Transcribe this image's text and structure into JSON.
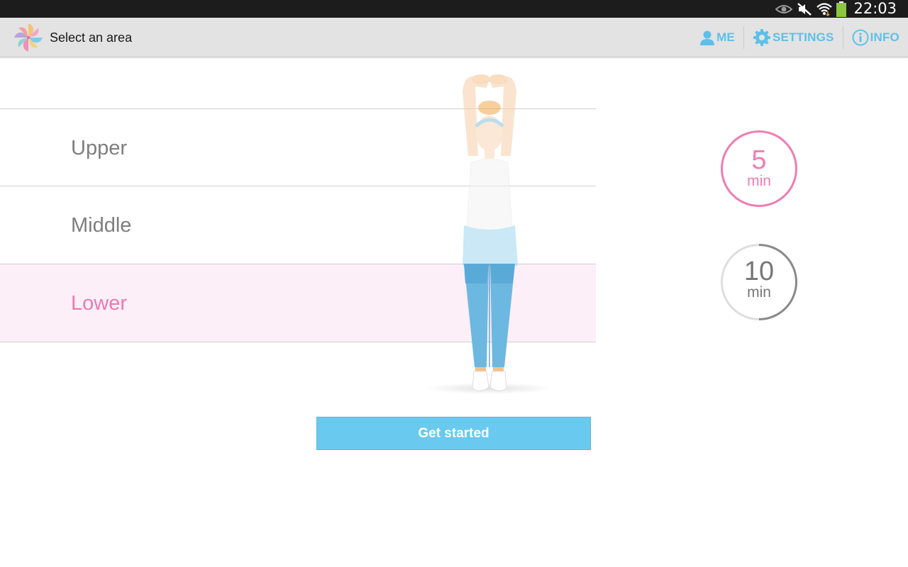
{
  "status_bar": {
    "time": "22:03",
    "icons": [
      "eye-icon",
      "mute-icon",
      "wifi-icon",
      "battery-icon"
    ]
  },
  "action_bar": {
    "title": "Select an area",
    "logo_icon": "pinwheel-icon",
    "actions": [
      {
        "label": "ME",
        "icon": "person-icon"
      },
      {
        "label": "SETTINGS",
        "icon": "gear-icon"
      },
      {
        "label": "INFO",
        "icon": "info-icon"
      }
    ]
  },
  "areas": {
    "items": [
      {
        "label": "Upper",
        "selected": false
      },
      {
        "label": "Middle",
        "selected": false
      },
      {
        "label": "Lower",
        "selected": true
      }
    ]
  },
  "durations": {
    "options": [
      {
        "value": "5",
        "unit": "min",
        "selected": true
      },
      {
        "value": "10",
        "unit": "min",
        "selected": false
      }
    ]
  },
  "start_button": {
    "label": "Get started"
  },
  "colors": {
    "accent_blue": "#5ec0ea",
    "accent_pink": "#ea7ab2",
    "selected_row_bg": "#fdeff7",
    "button_bg": "#6ac9ee"
  }
}
